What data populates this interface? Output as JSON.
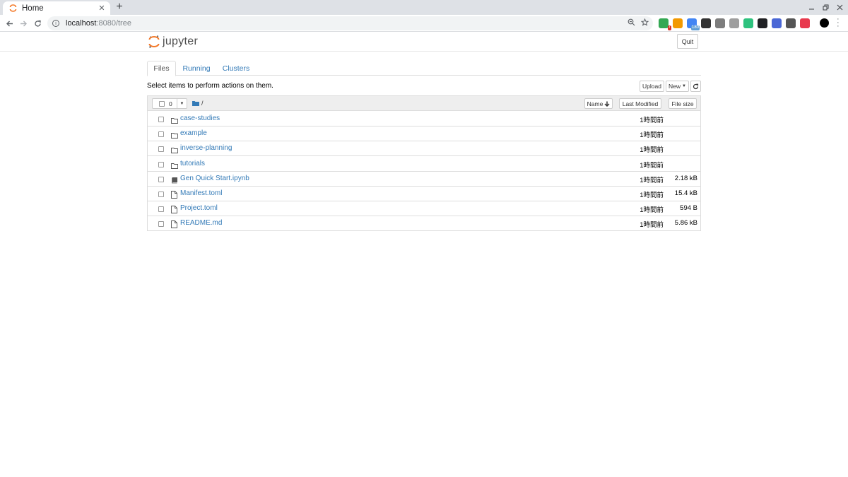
{
  "browser": {
    "tab_title": "Home",
    "close_glyph": "✕",
    "newtab_glyph": "+",
    "url_host": "localhost",
    "url_path": ":8080/tree",
    "extension_colors": [
      "#34a853",
      "#f29900",
      "#4285f4",
      "#333333",
      "#7d7d7d",
      "#9e9e9e",
      "#2ec27e",
      "#202124",
      "#4a67d6",
      "#555555",
      "#e8394d"
    ],
    "extension_badges": [
      "7",
      "",
      "180",
      "",
      "",
      "",
      "",
      "",
      "",
      "",
      ""
    ]
  },
  "jupyter": {
    "logo_text": "jupyter",
    "quit_label": "Quit",
    "brand_orange": "#f37726",
    "link_color": "#337ab7"
  },
  "tabs": [
    {
      "label": "Files",
      "active": true
    },
    {
      "label": "Running",
      "active": false
    },
    {
      "label": "Clusters",
      "active": false
    }
  ],
  "toolbar": {
    "hint": "Select items to perform actions on them.",
    "upload_label": "Upload",
    "new_label": "New",
    "refresh_icon": "refresh-icon"
  },
  "listing_header": {
    "selected_count": "0",
    "breadcrumb": "/",
    "name_label": "Name",
    "modified_label": "Last Modified",
    "size_label": "File size"
  },
  "rows": [
    {
      "type": "folder",
      "name": "case-studies",
      "modified": "1時間前",
      "size": ""
    },
    {
      "type": "folder",
      "name": "example",
      "modified": "1時間前",
      "size": ""
    },
    {
      "type": "folder",
      "name": "inverse-planning",
      "modified": "1時間前",
      "size": ""
    },
    {
      "type": "folder",
      "name": "tutorials",
      "modified": "1時間前",
      "size": ""
    },
    {
      "type": "notebook",
      "name": "Gen Quick Start.ipynb",
      "modified": "1時間前",
      "size": "2.18 kB"
    },
    {
      "type": "file",
      "name": "Manifest.toml",
      "modified": "1時間前",
      "size": "15.4 kB"
    },
    {
      "type": "file",
      "name": "Project.toml",
      "modified": "1時間前",
      "size": "594 B"
    },
    {
      "type": "file",
      "name": "README.md",
      "modified": "1時間前",
      "size": "5.86 kB"
    }
  ]
}
